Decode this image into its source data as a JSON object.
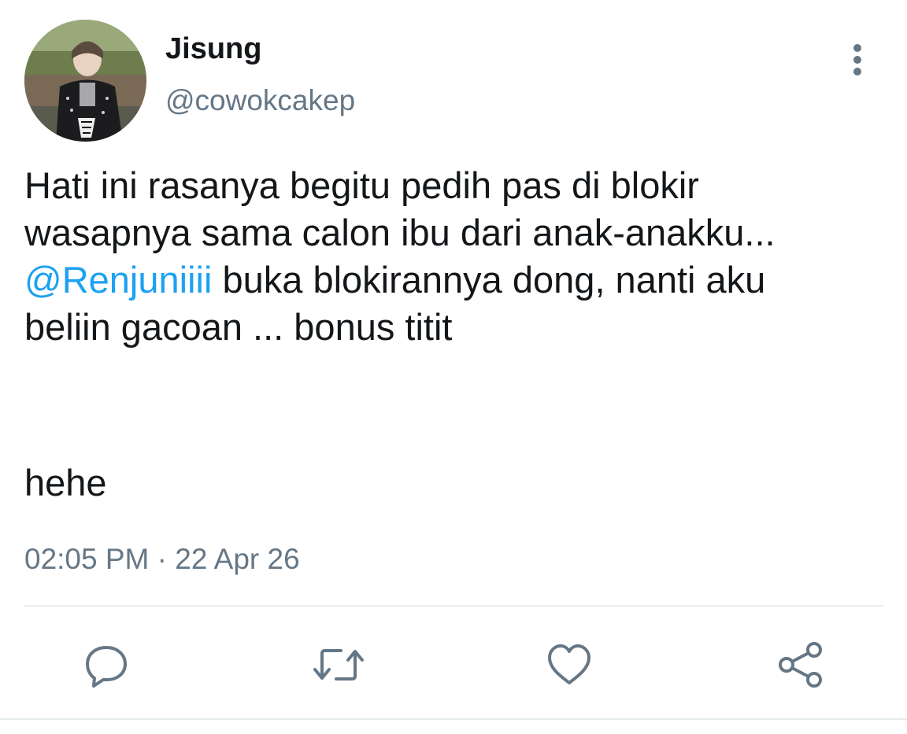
{
  "tweet": {
    "author": {
      "display_name": "Jisung",
      "handle": "@cowokcakep",
      "avatar_icon": "profile-photo"
    },
    "more_icon": "vertical-ellipsis-icon",
    "body": {
      "line1": "Hati ini rasanya begitu pedih pas di blokir",
      "line2": "wasapnya sama calon ibu dari anak-anakku...",
      "mention": "@Renjuniiii",
      "line3_rest": " buka blokirannya dong, nanti aku",
      "line4": "beliin gacoan ... bonus titit",
      "tail": "hehe"
    },
    "timestamp": "02:05 PM · 22 Apr 26",
    "actions": [
      {
        "name": "reply",
        "icon": "reply-icon"
      },
      {
        "name": "retweet",
        "icon": "retweet-icon"
      },
      {
        "name": "like",
        "icon": "heart-icon"
      },
      {
        "name": "share",
        "icon": "share-icon"
      }
    ],
    "colors": {
      "text": "#14171a",
      "secondary": "#657786",
      "link": "#1da1f2",
      "divider": "#e6ecf0"
    }
  }
}
